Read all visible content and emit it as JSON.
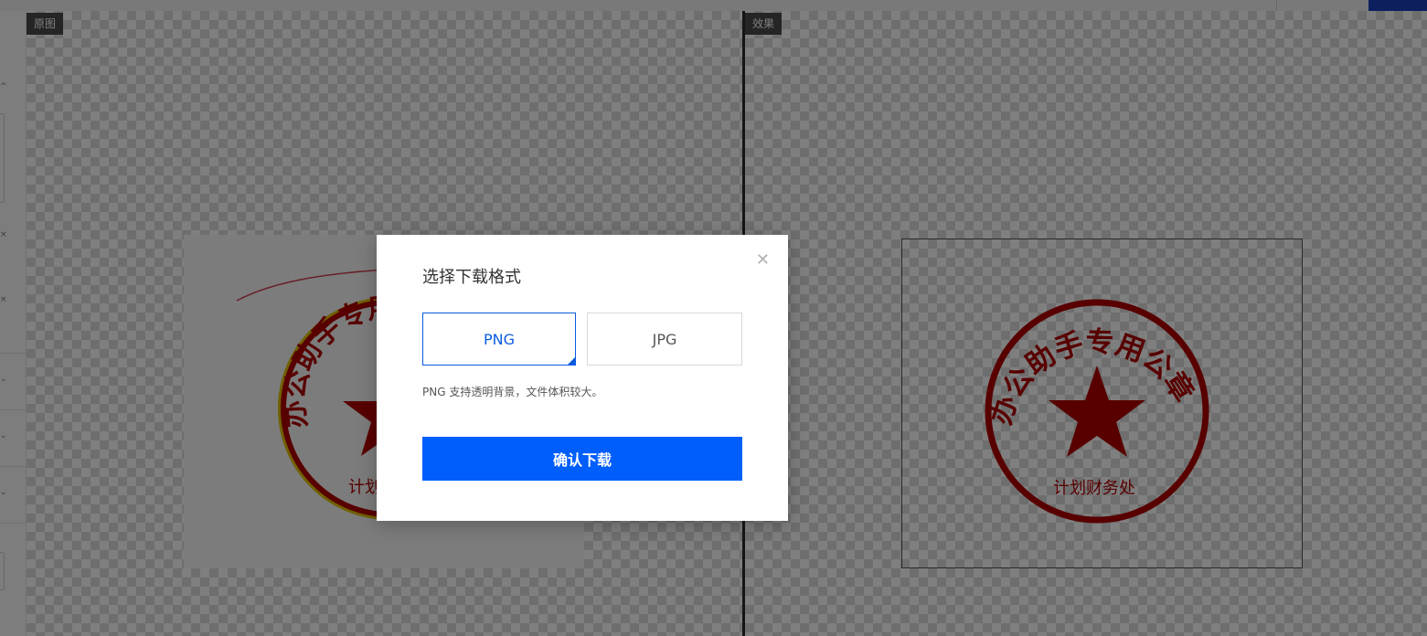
{
  "panes": {
    "left_label": "原图",
    "right_label": "效果"
  },
  "stamp": {
    "arc_text": "办公助手专用公章",
    "bottom_text": "计划财务处",
    "color": "#b00000",
    "original_outline_color": "#e0c000"
  },
  "dialog": {
    "title": "选择下载格式",
    "close_icon": "close-icon",
    "formats": [
      {
        "label": "PNG",
        "selected": true
      },
      {
        "label": "JPG",
        "selected": false
      }
    ],
    "description": "PNG 支持透明背景，文件体积较大。",
    "confirm_label": "确认下载"
  },
  "colors": {
    "accent": "#005efc",
    "overlay": "rgba(0,0,0,0.5)"
  }
}
